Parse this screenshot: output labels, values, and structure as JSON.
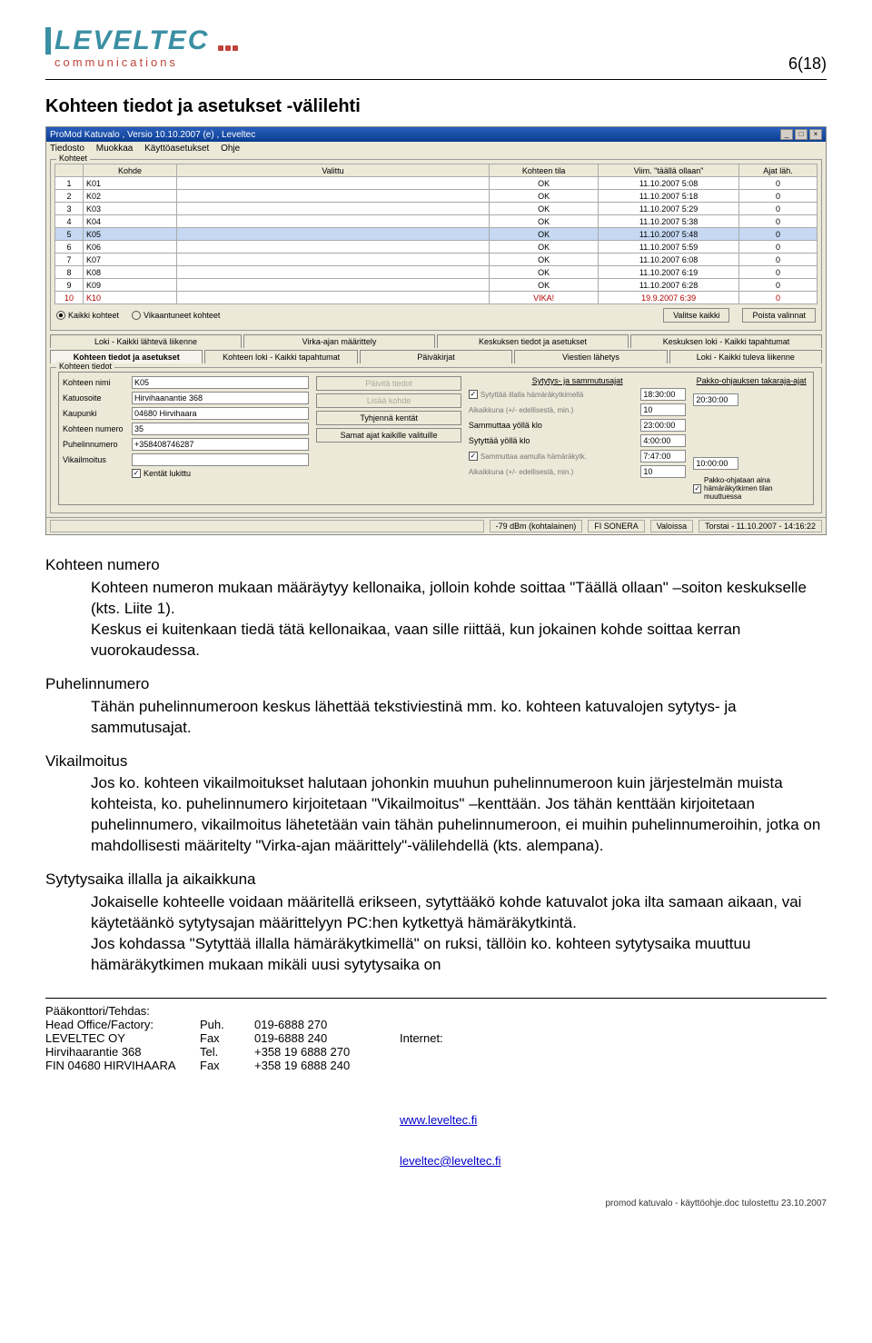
{
  "header": {
    "logo_top": "LEVELTEC",
    "logo_sub": "communications",
    "page_num": "6(18)"
  },
  "section_title": "Kohteen tiedot ja asetukset -välilehti",
  "app": {
    "title": "ProMod Katuvalo , Versio 10.10.2007 (e) , Leveltec",
    "menu": [
      "Tiedosto",
      "Muokkaa",
      "Käyttöasetukset",
      "Ohje"
    ],
    "groupbox_title": "Kohteet",
    "columns": [
      "",
      "Kohde",
      "Valittu",
      "Kohteen tila",
      "Viim. \"täällä ollaan\"",
      "Ajat läh."
    ],
    "rows": [
      {
        "n": "1",
        "kohde": "K01",
        "valittu": "",
        "tila": "OK",
        "viim": "11.10.2007 5:08",
        "ajat": "0",
        "sel": false,
        "vika": false
      },
      {
        "n": "2",
        "kohde": "K02",
        "valittu": "",
        "tila": "OK",
        "viim": "11.10.2007 5:18",
        "ajat": "0",
        "sel": false,
        "vika": false
      },
      {
        "n": "3",
        "kohde": "K03",
        "valittu": "",
        "tila": "OK",
        "viim": "11.10.2007 5:29",
        "ajat": "0",
        "sel": false,
        "vika": false
      },
      {
        "n": "4",
        "kohde": "K04",
        "valittu": "",
        "tila": "OK",
        "viim": "11.10.2007 5:38",
        "ajat": "0",
        "sel": false,
        "vika": false
      },
      {
        "n": "5",
        "kohde": "K05",
        "valittu": "",
        "tila": "OK",
        "viim": "11.10.2007 5:48",
        "ajat": "0",
        "sel": true,
        "vika": false
      },
      {
        "n": "6",
        "kohde": "K06",
        "valittu": "",
        "tila": "OK",
        "viim": "11.10.2007 5:59",
        "ajat": "0",
        "sel": false,
        "vika": false
      },
      {
        "n": "7",
        "kohde": "K07",
        "valittu": "",
        "tila": "OK",
        "viim": "11.10.2007 6:08",
        "ajat": "0",
        "sel": false,
        "vika": false
      },
      {
        "n": "8",
        "kohde": "K08",
        "valittu": "",
        "tila": "OK",
        "viim": "11.10.2007 6:19",
        "ajat": "0",
        "sel": false,
        "vika": false
      },
      {
        "n": "9",
        "kohde": "K09",
        "valittu": "",
        "tila": "OK",
        "viim": "11.10.2007 6:28",
        "ajat": "0",
        "sel": false,
        "vika": false
      },
      {
        "n": "10",
        "kohde": "K10",
        "valittu": "",
        "tila": "VIKA!",
        "viim": "19.9.2007 6:39",
        "ajat": "0",
        "sel": false,
        "vika": true
      }
    ],
    "filters": {
      "all": "Kaikki kohteet",
      "fault": "Vikaantuneet kohteet",
      "select_all": "Valitse kaikki",
      "clear": "Poista valinnat"
    },
    "tabs_top": [
      "Loki - Kaikki lähtevä liikenne",
      "Virka-ajan määrittely",
      "Keskuksen tiedot ja asetukset",
      "Keskuksen loki - Kaikki tapahtumat"
    ],
    "tabs_bottom": [
      "Kohteen tiedot ja asetukset",
      "Kohteen loki - Kaikki tapahtumat",
      "Päiväkirjat",
      "Viestien lähetys",
      "Loki - Kaikki tuleva liikenne"
    ],
    "detail_group": "Kohteen tiedot",
    "fields": {
      "nimi_lbl": "Kohteen nimi",
      "nimi": "K05",
      "katu_lbl": "Katuosoite",
      "katu": "Hirvihaanantie 368",
      "kaupunki_lbl": "Kaupunki",
      "kaupunki": "04680 Hirvihaara",
      "numero_lbl": "Kohteen numero",
      "numero": "35",
      "puh_lbl": "Puhelinnumero",
      "puh": "+358408746287",
      "vika_lbl": "Vikailmoitus",
      "vika": "",
      "locked": "Kentät lukittu"
    },
    "buttons": {
      "paivita": "Päivitä tiedot",
      "lisaa": "Lisää kohde",
      "tyhjenna": "Tyhjennä kentät",
      "samat": "Samat ajat kaikille valituille"
    },
    "times": {
      "header": "Sytytys- ja sammutusajat",
      "syt_ilta_chk": "Sytyttää illalla hämäräkytkimellä",
      "aikak_ed": "Aikaikkuna (+/- edellisestä, min.)",
      "sam_yolla": "Sammuttaa yöllä klo",
      "syt_yolla": "Sytyttää yöllä klo",
      "sam_aamu": "Sammuttaa aamulla hämäräkytk.",
      "aikak_ed2": "Aikaikkuna (+/- edellisestä, min.)",
      "v1": "18:30:00",
      "v2": "10",
      "v3": "23:00:00",
      "v4": "4:00:00",
      "v5": "7:47:00",
      "v6": "10"
    },
    "pakko": {
      "header": "Pakko-ohjauksen takaraja-ajat",
      "v1": "20:30:00",
      "v2": "10:00:00",
      "chk": "Pakko-ohjataan aina hämäräkytkimen tilan muuttuessa"
    },
    "status": {
      "signal": "-79 dBm (kohtalainen)",
      "net": "FI SONERA",
      "state": "Valoissa",
      "time": "Torstai - 11.10.2007 - 14:16:22"
    }
  },
  "doc": {
    "h1": "Kohteen numero",
    "p1": "Kohteen numeron mukaan määräytyy kellonaika, jolloin kohde soittaa \"Täällä ollaan\" –soiton keskukselle (kts. Liite 1).",
    "p1b": "Keskus ei kuitenkaan tiedä tätä kellonaikaa, vaan sille riittää, kun jokainen kohde soittaa kerran vuorokaudessa.",
    "h2": "Puhelinnumero",
    "p2": "Tähän puhelinnumeroon keskus lähettää tekstiviestinä mm. ko. kohteen katuvalojen sytytys- ja sammutusajat.",
    "h3": "Vikailmoitus",
    "p3": "Jos ko. kohteen vikailmoitukset halutaan johonkin muuhun puhelinnumeroon kuin järjestelmän muista kohteista, ko. puhelinnumero kirjoitetaan \"Vikailmoitus\" –kenttään. Jos tähän kenttään kirjoitetaan puhelinnumero, vikailmoitus lähetetään vain tähän puhelinnumeroon, ei muihin puhelinnumeroihin, jotka on mahdollisesti määritelty \"Virka-ajan määrittely\"-välilehdellä (kts. alempana).",
    "h4": "Sytytysaika illalla ja aikaikkuna",
    "p4": "Jokaiselle kohteelle voidaan määritellä erikseen, sytyttääkö kohde katuvalot joka ilta samaan aikaan, vai käytetäänkö sytytysajan määrittelyyn PC:hen kytkettyä hämäräkytkintä.",
    "p4b": "Jos kohdassa \"Sytyttää illalla hämäräkytkimellä\" on ruksi, tällöin ko. kohteen sytytysaika muuttuu hämäräkytkimen mukaan mikäli uusi sytytysaika on"
  },
  "footer": {
    "col1": [
      "Pääkonttori/Tehdas:",
      "Head Office/Factory:",
      "LEVELTEC OY",
      "Hirvihaarantie 368",
      "FIN 04680 HIRVIHAARA"
    ],
    "col2": [
      "",
      "Puh.",
      "Fax",
      "Tel.",
      "Fax"
    ],
    "col3": [
      "",
      "019-6888 270",
      "019-6888 240",
      "+358 19 6888 270",
      "+358 19 6888 240"
    ],
    "col4_h": "Internet:",
    "col4_a": "www.leveltec.fi",
    "col4_b": "leveltec@leveltec.fi",
    "print": "promod katuvalo - käyttöohje.doc tulostettu 23.10.2007"
  }
}
